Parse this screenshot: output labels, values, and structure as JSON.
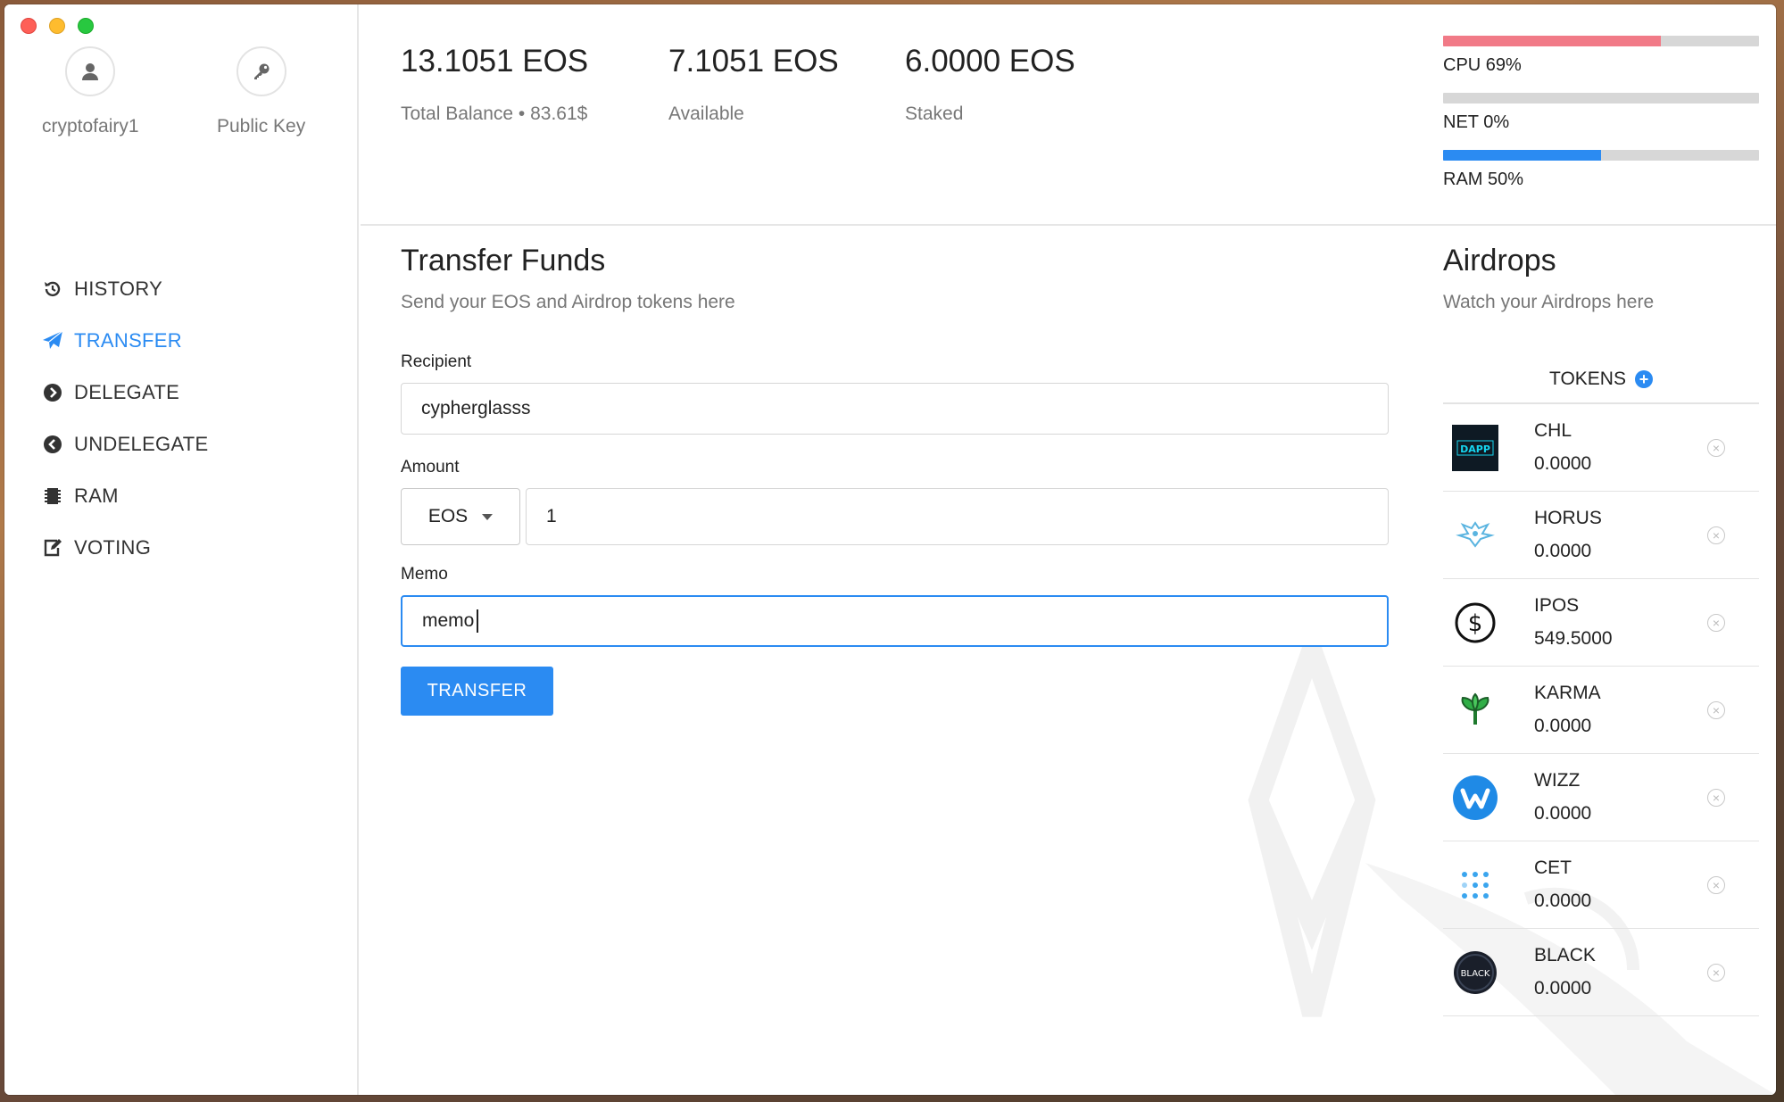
{
  "account": {
    "name": "cryptofairy1",
    "public_key_label": "Public Key"
  },
  "nav": [
    {
      "label": "HISTORY",
      "icon": "history-icon",
      "active": false
    },
    {
      "label": "TRANSFER",
      "icon": "paper-plane-icon",
      "active": true
    },
    {
      "label": "DELEGATE",
      "icon": "chevron-circle-right-icon",
      "active": false
    },
    {
      "label": "UNDELEGATE",
      "icon": "chevron-circle-left-icon",
      "active": false
    },
    {
      "label": "RAM",
      "icon": "memory-chip-icon",
      "active": false
    },
    {
      "label": "VOTING",
      "icon": "edit-icon",
      "active": false
    }
  ],
  "stats": {
    "total": {
      "value": "13.1051 EOS",
      "label": "Total Balance • 83.61$"
    },
    "available": {
      "value": "7.1051 EOS",
      "label": "Available"
    },
    "staked": {
      "value": "6.0000 EOS",
      "label": "Staked"
    }
  },
  "resources": [
    {
      "label": "CPU 69%",
      "percent": 69,
      "color": "#f17a87"
    },
    {
      "label": "NET 0%",
      "percent": 0,
      "color": "#2b8bf2"
    },
    {
      "label": "RAM 50%",
      "percent": 50,
      "color": "#2b8bf2"
    }
  ],
  "transfer": {
    "title": "Transfer Funds",
    "subtitle": "Send your EOS and Airdrop tokens here",
    "recipient_label": "Recipient",
    "recipient_value": "cypherglasss",
    "amount_label": "Amount",
    "token_selected": "EOS",
    "amount_value": "1",
    "memo_label": "Memo",
    "memo_value": "memo",
    "button_label": "TRANSFER"
  },
  "airdrops": {
    "title": "Airdrops",
    "subtitle": "Watch your Airdrops here",
    "tokens_header": "TOKENS",
    "tokens": [
      {
        "name": "CHL",
        "amount": "0.0000",
        "logo": "challenge-dapp-logo",
        "logo_text": "DAPP"
      },
      {
        "name": "HORUS",
        "amount": "0.0000",
        "logo": "horus-eagle-logo"
      },
      {
        "name": "IPOS",
        "amount": "549.5000",
        "logo": "dollar-circle-logo"
      },
      {
        "name": "KARMA",
        "amount": "0.0000",
        "logo": "karma-sprout-logo"
      },
      {
        "name": "WIZZ",
        "amount": "0.0000",
        "logo": "wizz-w-logo"
      },
      {
        "name": "CET",
        "amount": "0.0000",
        "logo": "cet-dots-logo"
      },
      {
        "name": "BLACK",
        "amount": "0.0000",
        "logo": "black-circle-logo",
        "logo_text": "BLACK"
      }
    ]
  },
  "colors": {
    "accent": "#2b8bf2",
    "cpu": "#f17a87",
    "bar_bg": "#d7d7d7"
  }
}
